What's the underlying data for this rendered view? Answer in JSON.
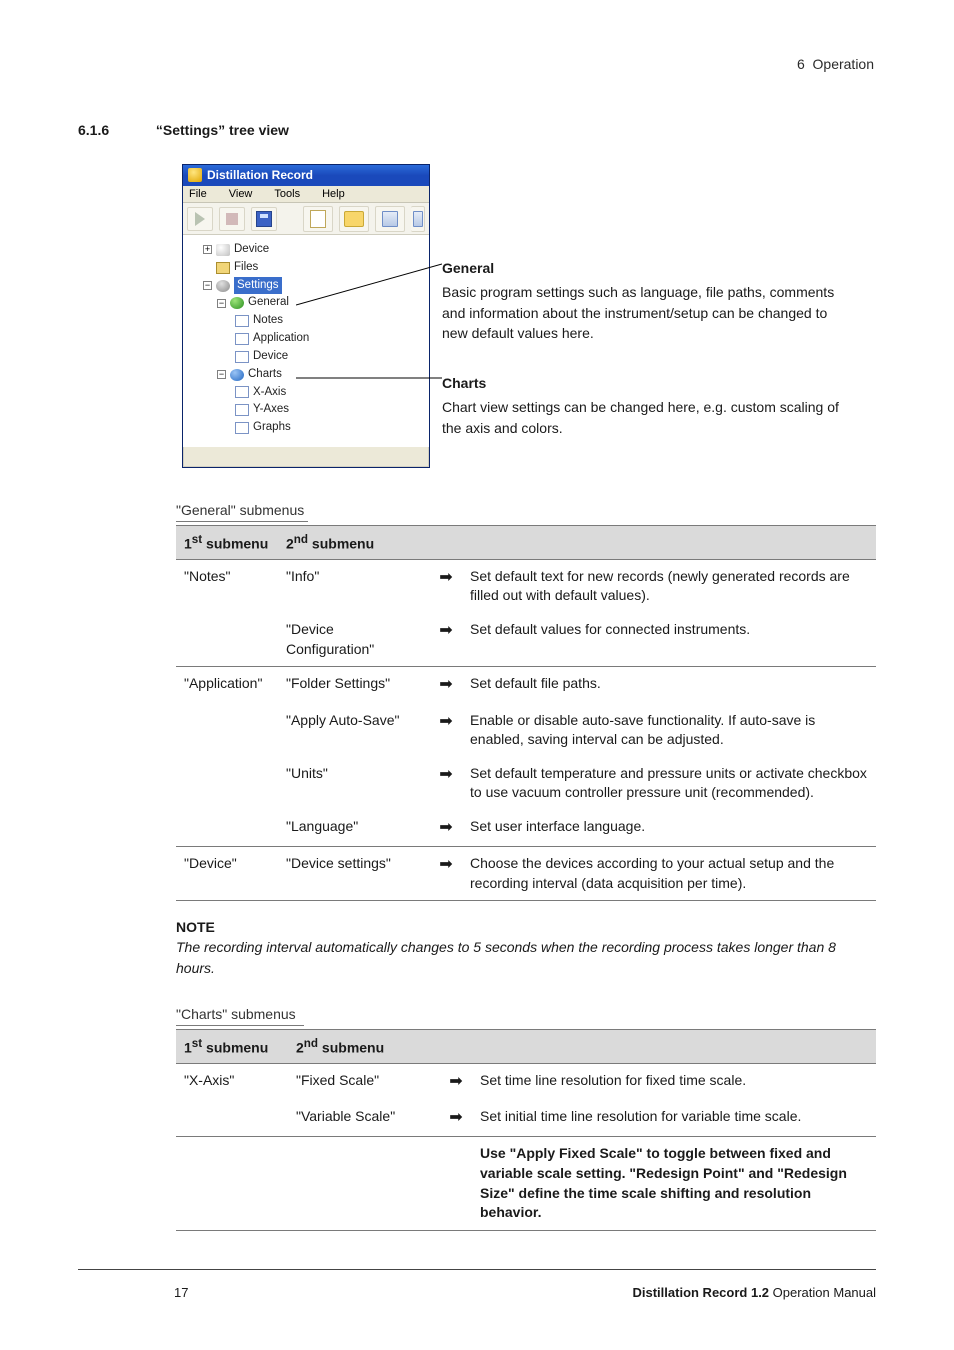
{
  "header": {
    "chapter_num": "6",
    "chapter_title": "Operation"
  },
  "section": {
    "number": "6.1.6",
    "title": "“Settings” tree view"
  },
  "window": {
    "title": "Distillation Record",
    "menus": [
      "File",
      "View",
      "Tools",
      "Help"
    ],
    "tree": {
      "device": "Device",
      "files": "Files",
      "settings": "Settings",
      "general": "General",
      "notes": "Notes",
      "application": "Application",
      "device2": "Device",
      "charts": "Charts",
      "xaxis": "X-Axis",
      "yaxes": "Y-Axes",
      "graphs": "Graphs"
    }
  },
  "callouts": {
    "general": {
      "title": "General",
      "body": "Basic program settings such as language, file paths, comments and information about the instrument/setup can be changed to new default values here."
    },
    "charts": {
      "title": "Charts",
      "body": "Chart view settings can be changed here, e.g. custom scaling of the axis and colors."
    }
  },
  "tables": {
    "general": {
      "caption": "\"General\" submenus",
      "head": {
        "c1": "1",
        "c1_sup": "st",
        "c1_tail": " submenu",
        "c2": "2",
        "c2_sup": "nd",
        "c2_tail": " submenu"
      },
      "rows": [
        {
          "sep": true,
          "c1": "\"Notes\"",
          "c2": "\"Info\"",
          "desc": "Set default text for new records (newly generated records are filled out with default values)."
        },
        {
          "sep": false,
          "c1": "",
          "c2": "\"Device Configuration\"",
          "desc": "Set default values for connected instruments."
        },
        {
          "sep": true,
          "c1": "\"Application\"",
          "c2": "\"Folder Settings\"",
          "desc": "Set default file paths."
        },
        {
          "sep": false,
          "c1": "",
          "c2": "\"Apply Auto-Save\"",
          "desc": "Enable or disable auto-save functionality. If auto-save is enabled, saving interval can be adjusted."
        },
        {
          "sep": false,
          "c1": "",
          "c2": "\"Units\"",
          "desc": "Set default temperature and pressure units or activate checkbox to use vacuum controller pressure unit (recommended)."
        },
        {
          "sep": false,
          "c1": "",
          "c2": "\"Language\"",
          "desc": "Set user interface language."
        },
        {
          "sep": true,
          "c1": "\"Device\"",
          "c2": "\"Device settings\"",
          "desc": "Choose the devices according to your actual setup and the recording interval (data acquisition per time)."
        }
      ]
    },
    "charts": {
      "caption": "\"Charts\" submenus",
      "head": {
        "c1": "1",
        "c1_sup": "st",
        "c1_tail": " submenu",
        "c2": "2",
        "c2_sup": "nd",
        "c2_tail": " submenu"
      },
      "rows": [
        {
          "sep": true,
          "c1": "\"X-Axis\"",
          "c2": "\"Fixed Scale\"",
          "desc": "Set time line resolution for fixed time scale."
        },
        {
          "sep": false,
          "c1": "",
          "c2": "\"Variable Scale\"",
          "desc": "Set initial time line resolution for variable time scale."
        }
      ],
      "tip": "Use \"Apply Fixed Scale\" to toggle between fixed and variable scale setting. \"Redesign Point\" and \"Redesign Size\" define the time scale shifting and resolution behavior."
    }
  },
  "note": {
    "heading": "NOTE",
    "body": "The recording interval automatically changes to 5 seconds when the recording process takes longer than 8 hours."
  },
  "footer": {
    "page": "17",
    "product": "Distillation Record 1.2",
    "doc": " Operation Manual"
  }
}
